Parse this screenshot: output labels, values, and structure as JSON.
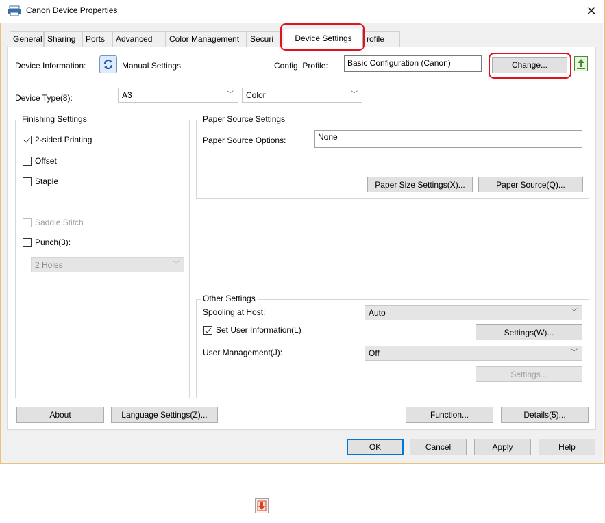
{
  "window": {
    "title": "Canon Device Properties",
    "close_label": "✕"
  },
  "tabs": [
    "General",
    "Sharing",
    "Ports",
    "Advanced",
    "Color Management",
    "Securi",
    "Device Settings",
    "rofile"
  ],
  "device_info": {
    "label": "Device Information:",
    "mode": "Manual Settings"
  },
  "config_profile": {
    "label": "Config. Profile:",
    "value": "Basic Configuration (Canon)",
    "change_label": "Change..."
  },
  "device_type": {
    "label": "Device Type(8):",
    "model": "A3",
    "color_mode": "Color"
  },
  "finishing": {
    "title": "Finishing Settings",
    "two_sided": "2-sided Printing",
    "offset": "Offset",
    "staple": "Staple",
    "saddle_stitch": "Saddle Stitch",
    "punch": "Punch(3):",
    "punch_holes": "2 Holes"
  },
  "paper_source": {
    "title": "Paper Source Settings",
    "options_label": "Paper Source Options:",
    "options_value": "None",
    "size_settings_label": "Paper Size Settings(X)...",
    "source_label": "Paper Source(Q)..."
  },
  "other_settings": {
    "title": "Other Settings",
    "spooling_label": "Spooling at Host:",
    "spooling_value": "Auto",
    "set_user_info": "Set User Information(L)",
    "settings_w_label": "Settings(W)...",
    "user_mgmt_label": "User Management(J):",
    "user_mgmt_value": "Off",
    "settings_label": "Settings..."
  },
  "bottom_buttons": {
    "about": "About",
    "language": "Language Settings(Z)...",
    "function": "Function...",
    "details": "Details(5)..."
  },
  "dialog_buttons": {
    "ok": "OK",
    "cancel": "Cancel",
    "apply": "Apply",
    "help": "Help"
  },
  "colors": {
    "highlight_ring": "#e0121d",
    "accent": "#0078d7",
    "window_border": "#e6c27a"
  }
}
